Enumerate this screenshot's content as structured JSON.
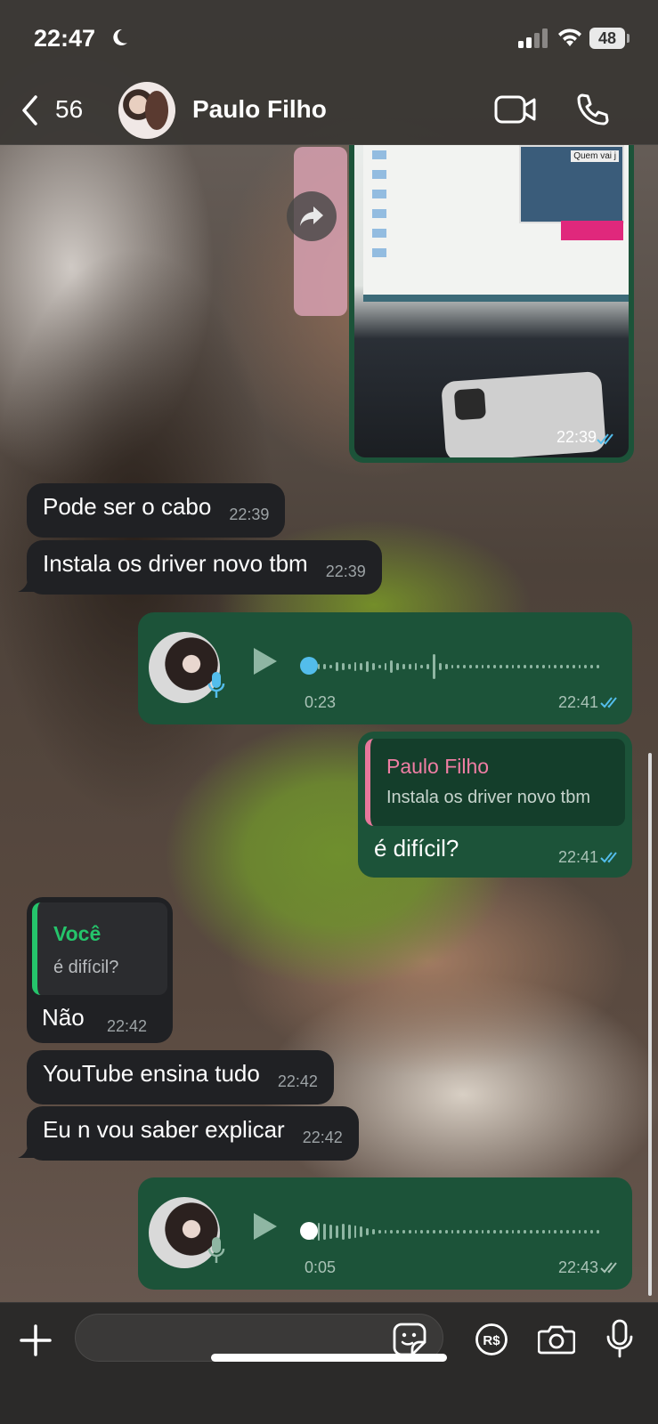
{
  "status_bar": {
    "time": "22:47",
    "battery": "48",
    "icons": [
      "moon-icon",
      "signal-icon",
      "wifi-icon",
      "battery-icon"
    ]
  },
  "header": {
    "back_count": "56",
    "contact_name": "Paulo Filho",
    "icons": [
      "back-chevron-icon",
      "video-call-icon",
      "phone-call-icon"
    ]
  },
  "image_message": {
    "time": "22:39",
    "window_label": "Quem vai j",
    "read_color": "#53bdeb"
  },
  "messages": {
    "m1": {
      "text": "Pode ser o cabo",
      "time": "22:39"
    },
    "m2": {
      "text": "Instala os driver novo tbm",
      "time": "22:39"
    },
    "voice1": {
      "duration": "0:23",
      "time": "22:41",
      "progress": 0,
      "read": true
    },
    "reply_out": {
      "quote_name": "Paulo Filho",
      "quote_text": "Instala os driver novo tbm",
      "text": "é difícil?",
      "time": "22:41"
    },
    "reply_in": {
      "quote_name": "Você",
      "quote_text": "é difícil?",
      "text": "Não",
      "time": "22:42"
    },
    "m3": {
      "text": "YouTube ensina tudo",
      "time": "22:42"
    },
    "m4": {
      "text": "Eu n vou saber explicar",
      "time": "22:42"
    },
    "voice2": {
      "duration": "0:05",
      "time": "22:43",
      "progress": 0,
      "read": false
    }
  },
  "input_bar": {
    "placeholder": "",
    "icons": [
      "plus-icon",
      "sticker-icon",
      "pix-payment-icon",
      "camera-icon",
      "mic-icon"
    ]
  },
  "colors": {
    "outgoing_bubble": "#1c5339",
    "incoming_bubble": "#202124",
    "read_ticks": "#53bdeb",
    "reply_accent_contact": "#e7779b",
    "reply_accent_you": "#25c46b"
  }
}
